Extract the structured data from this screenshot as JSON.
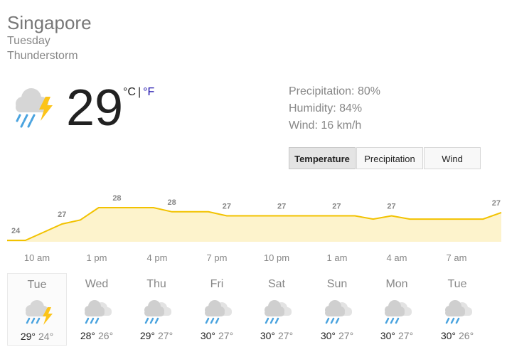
{
  "location": "Singapore",
  "day": "Tuesday",
  "condition": "Thunderstorm",
  "current": {
    "temperature": "29",
    "unit_c": "°C",
    "unit_sep": "|",
    "unit_f": "°F",
    "icon": "thunderstorm-icon"
  },
  "stats": {
    "precipitation": "Precipitation: 80%",
    "humidity": "Humidity: 84%",
    "wind": "Wind: 16 km/h"
  },
  "tabs": [
    {
      "label": "Temperature",
      "active": true
    },
    {
      "label": "Precipitation",
      "active": false
    },
    {
      "label": "Wind",
      "active": false
    }
  ],
  "colors": {
    "line": "#f2c200",
    "fill": "#fdf3cc",
    "label": "#878787"
  },
  "chart_data": {
    "type": "area",
    "x": [
      "10 am",
      "1 pm",
      "4 pm",
      "7 pm",
      "10 pm",
      "1 am",
      "4 am",
      "7 am"
    ],
    "labels": [
      "24",
      "27",
      "28",
      "28",
      "27",
      "27",
      "27",
      "27",
      "27"
    ],
    "series": [
      {
        "values": [
          24,
          24,
          25,
          26,
          26.5,
          28,
          28,
          28,
          28,
          27.5,
          27.5,
          27.5,
          27,
          27,
          27,
          27,
          27,
          27,
          27,
          27,
          26.6,
          27,
          26.6,
          26.6,
          26.6,
          26.6,
          26.6,
          27.4
        ]
      }
    ]
  },
  "forecast": [
    {
      "day": "Tue",
      "high": "29°",
      "low": "24°",
      "icon": "thunderstorm-icon",
      "selected": true
    },
    {
      "day": "Wed",
      "high": "28°",
      "low": "26°",
      "icon": "rain-icon",
      "selected": false
    },
    {
      "day": "Thu",
      "high": "29°",
      "low": "27°",
      "icon": "rain-icon",
      "selected": false
    },
    {
      "day": "Fri",
      "high": "30°",
      "low": "27°",
      "icon": "rain-icon",
      "selected": false
    },
    {
      "day": "Sat",
      "high": "30°",
      "low": "27°",
      "icon": "rain-icon",
      "selected": false
    },
    {
      "day": "Sun",
      "high": "30°",
      "low": "27°",
      "icon": "rain-icon",
      "selected": false
    },
    {
      "day": "Mon",
      "high": "30°",
      "low": "27°",
      "icon": "rain-icon",
      "selected": false
    },
    {
      "day": "Tue",
      "high": "30°",
      "low": "26°",
      "icon": "rain-icon",
      "selected": false
    }
  ]
}
